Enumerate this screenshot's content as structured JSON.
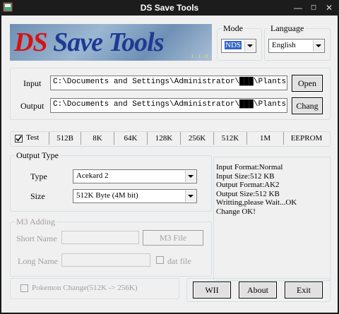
{
  "window": {
    "title": "DS Save Tools"
  },
  "logo": {
    "text_ds": "DS",
    "text_save": "Save",
    "text_tools": "Tools",
    "version": "1.1.0"
  },
  "mode": {
    "label": "Mode",
    "value": "NDS"
  },
  "language": {
    "label": "Language",
    "value": "English"
  },
  "io": {
    "input_label": "Input",
    "input_value": "C:\\Documents and Settings\\Administrator\\███\\Plants vs Zombie",
    "output_label": "Output",
    "output_value": "C:\\Documents and Settings\\Administrator\\███\\Plants vs Zombie",
    "open_button": "Open",
    "change_button": "Chang"
  },
  "sizes": {
    "test_label": "Test",
    "options": [
      "512B",
      "8K",
      "64K",
      "128K",
      "256K",
      "512K",
      "1M",
      "EEPROM"
    ]
  },
  "output_type": {
    "legend": "Output Type",
    "type_label": "Type",
    "type_value": "Acekard 2",
    "size_label": "Size",
    "size_value": "512K Byte (4M bit)"
  },
  "m3": {
    "legend": "M3 Adding",
    "short_name_label": "Short Name",
    "long_name_label": "Long Name",
    "m3_file_button": "M3 File",
    "dat_file_label": "dat file"
  },
  "log": {
    "lines": [
      "Input Format:Normal",
      "Input Size:512 KB",
      "Output Format:AK2",
      "Output Size:512 KB",
      "Writting,please Wait...OK",
      "Change OK!"
    ]
  },
  "pokemon": {
    "label": "Pokemon Change(512K -> 256K)"
  },
  "buttons": {
    "wii": "WII",
    "about": "About",
    "exit": "Exit"
  },
  "colors": {
    "logo_red": "#d41414",
    "logo_blue": "#1f3a93",
    "logo_bg": "#7ea0c0"
  }
}
